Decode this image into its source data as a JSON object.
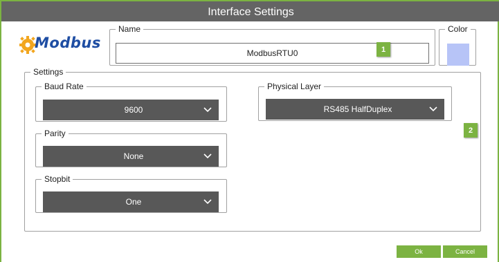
{
  "window": {
    "title": "Interface Settings"
  },
  "logo": {
    "text": "Modbus",
    "icon": "gear-icon"
  },
  "name_group": {
    "legend": "Name",
    "value": "ModbusRTU0",
    "badge": "1"
  },
  "color_group": {
    "legend": "Color",
    "swatch_color": "#b7c4f7"
  },
  "settings": {
    "legend": "Settings",
    "baud_rate": {
      "legend": "Baud Rate",
      "value": "9600"
    },
    "parity": {
      "legend": "Parity",
      "value": "None"
    },
    "stopbit": {
      "legend": "Stopbit",
      "value": "One"
    },
    "physical_layer": {
      "legend": "Physical Layer",
      "value": "RS485 HalfDuplex"
    },
    "badge": "2"
  },
  "buttons": {
    "ok": "Ok",
    "cancel": "Cancel"
  },
  "colors": {
    "accent": "#7cb342",
    "titlebar": "#646464",
    "select_bg": "#585858"
  }
}
